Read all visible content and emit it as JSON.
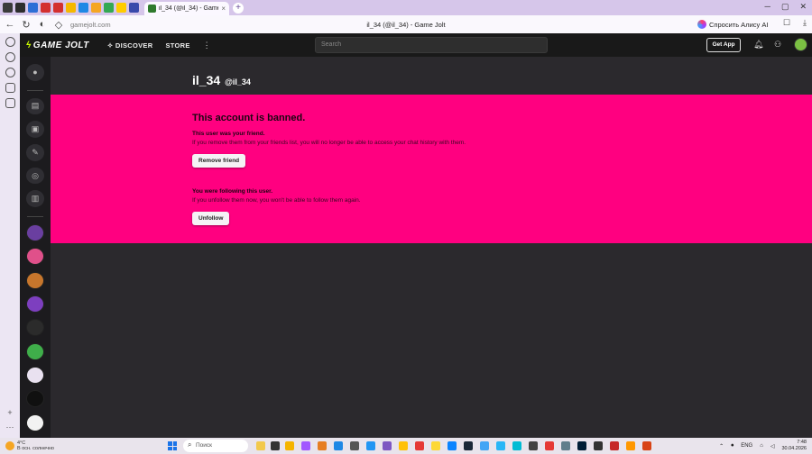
{
  "browser": {
    "active_tab_title": "il_34 (@il_34) - Game Jo",
    "new_tab_symbol": "+",
    "url": "gamejolt.com",
    "page_title": "il_34 (@il_34) - Game Jolt",
    "alice_label": "Спросить Алису AI",
    "other_tab_favicon_colors": [
      "#3a3a3a",
      "#2d2d2d",
      "#2d6fd6",
      "#d32f2f",
      "#d32f2f",
      "#f5b800",
      "#1e88e5",
      "#f5a623",
      "#34a853",
      "#ffcc00",
      "#3949ab"
    ]
  },
  "gj": {
    "logo": "GAME JOLT",
    "nav": {
      "discover": "DISCOVER",
      "store": "STORE"
    },
    "search_placeholder": "Search",
    "get_app": "Get App"
  },
  "profile": {
    "name": "il_34",
    "handle": "@il_34"
  },
  "ban": {
    "title": "This account is banned.",
    "friend_heading": "This user was your friend.",
    "friend_text": "If you remove them from your friends list, you will no longer be able to access your chat history with them.",
    "remove_friend_btn": "Remove friend",
    "follow_heading": "You were following this user.",
    "follow_text": "If you unfollow them now, you won't be able to follow them again.",
    "unfollow_btn": "Unfollow"
  },
  "taskbar": {
    "weather_temp": "4°C",
    "weather_desc": "В осн. солнечно",
    "search_label": "Поиск",
    "lang": "ENG",
    "time": "7:48",
    "date": "30.04.2026"
  },
  "colors": {
    "ban_background": "#ff0080",
    "page_background": "#2b292d",
    "header_background": "#191919",
    "logo_accent": "#ccff00"
  },
  "rail_avatar_colors": [
    "#6a3fa0",
    "#e0508a",
    "#c7762c",
    "#7d3fbf",
    "#2b2b2b",
    "#3fae4a",
    "#e9e1f0",
    "#101010",
    "#f2f2f2"
  ]
}
